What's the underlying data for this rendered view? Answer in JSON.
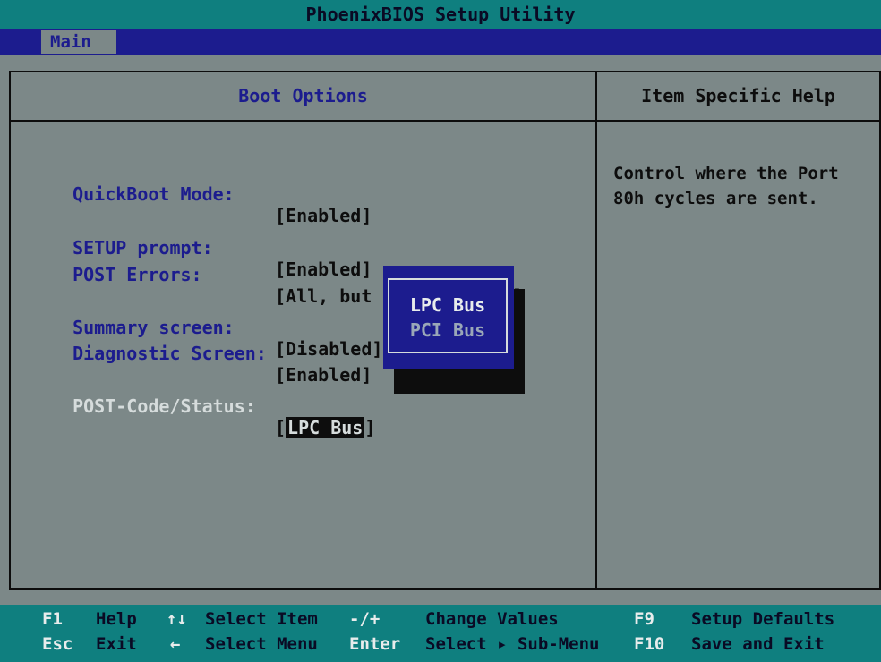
{
  "window": {
    "title": "PhoenixBIOS Setup Utility"
  },
  "menubar": {
    "tabs": [
      {
        "label": "Main"
      }
    ]
  },
  "panel": {
    "title": "Boot Options",
    "help_title": "Item Specific Help",
    "help_text": "Control where the Port 80h cycles are sent."
  },
  "settings": [
    {
      "label": "QuickBoot Mode:",
      "value": "[Enabled]"
    },
    {
      "label": "SETUP prompt:",
      "value": "[Enabled]"
    },
    {
      "label": "POST Errors:",
      "value": "[All, but not keyboard]"
    },
    {
      "label": "Summary screen:",
      "value": "[Disabled]"
    },
    {
      "label": "Diagnostic Screen:",
      "value": "[Enabled]"
    },
    {
      "label": "POST-Code/Status:",
      "value_open": "[",
      "value": "LPC Bus",
      "value_close": "]"
    }
  ],
  "popup": {
    "options": [
      "LPC Bus",
      "PCI Bus"
    ],
    "selected": "LPC Bus"
  },
  "footer": {
    "row1": [
      {
        "key": "F1",
        "action": "Help"
      },
      {
        "key": "↑↓",
        "action": "Select Item"
      },
      {
        "key": "-/+",
        "action": "Change Values"
      },
      {
        "key": "F9",
        "action": "Setup Defaults"
      }
    ],
    "row2": [
      {
        "key": "Esc",
        "action": "Exit"
      },
      {
        "key": "←",
        "action": "Select Menu"
      },
      {
        "key": "Enter",
        "action": "Select ▸ Sub-Menu"
      },
      {
        "key": "F10",
        "action": "Save and Exit"
      }
    ]
  },
  "colors": {
    "background": "#7c8888",
    "title_bar": "#0f7f7f",
    "menu_bar": "#1c1c8e",
    "label": "#1c1c8e"
  }
}
